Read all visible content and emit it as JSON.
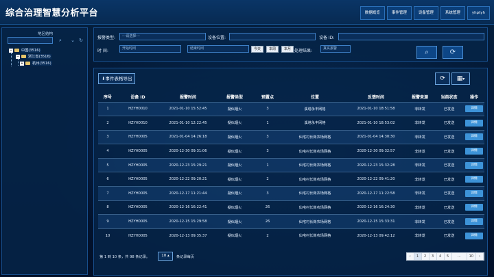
{
  "app": {
    "title": "综合治理智慧分析平台"
  },
  "nav": [
    {
      "label": "数据概览"
    },
    {
      "label": "事件管理"
    },
    {
      "label": "设备管理"
    },
    {
      "label": "系统管理"
    },
    {
      "label": "yhptyh"
    }
  ],
  "sidebar": {
    "title": "地区结构",
    "search_placeholder": "",
    "tree": [
      {
        "toggle": "−",
        "label": "中国(3516)"
      },
      {
        "toggle": "−",
        "label": "浙江省(3516)"
      },
      {
        "toggle": "+",
        "label": "杭州(3516)"
      }
    ]
  },
  "filter": {
    "alarm_type_label": "报警类型:",
    "alarm_type_value": "---请选择---",
    "device_location_label": "设备位置:",
    "device_location_value": "",
    "device_id_label": "设备 ID:",
    "device_id_value": "",
    "time_label": "时    间:",
    "start_placeholder": "开始时间",
    "end_placeholder": "结束时间",
    "today": "今天",
    "this_week": "本周",
    "this_month": "本月",
    "result_label": "处理结果:",
    "result_value": "真实报警"
  },
  "table": {
    "export_label": "事件表格导出",
    "headers": [
      "序号",
      "设备 ID",
      "报警时间",
      "报警类型",
      "预置点",
      "位置",
      "反馈时间",
      "报警来源",
      "当前状态",
      "操作"
    ],
    "detail_label": "详情",
    "rows": [
      [
        "1",
        "HZYH0010",
        "2021-01-10 15:52:45",
        "疑似烟火",
        "3",
        "溪塔永丰网格",
        "2021-01-10 18:51:58",
        "非转发",
        "已发送"
      ],
      [
        "2",
        "HZYH0010",
        "2021-01-10 12:22:45",
        "疑似烟火",
        "1",
        "溪塔永丰网格",
        "2021-01-10 18:53:02",
        "非转发",
        "已发送"
      ],
      [
        "3",
        "HZYH0005",
        "2021-01-04 14:26:18",
        "疑似烟火",
        "3",
        "仙宅村长岗农场网格",
        "2021-01-04 14:30:30",
        "非转发",
        "已发送"
      ],
      [
        "4",
        "HZYH0005",
        "2020-12-30 09:31:06",
        "疑似烟火",
        "3",
        "仙宅村长岗农场网格",
        "2020-12-30 09:32:57",
        "非转发",
        "已发送"
      ],
      [
        "5",
        "HZYH0005",
        "2020-12-23 15:29:21",
        "疑似烟火",
        "1",
        "仙宅村长岗农场网格",
        "2020-12-23 15:32:28",
        "非转发",
        "已发送"
      ],
      [
        "6",
        "HZYH0005",
        "2020-12-22 09:20:21",
        "疑似烟火",
        "2",
        "仙宅村长岗农场网格",
        "2020-12-22 09:41:20",
        "非转发",
        "已发送"
      ],
      [
        "7",
        "HZYH0005",
        "2020-12-17 11:21:44",
        "疑似烟火",
        "3",
        "仙宅村长岗农场网格",
        "2020-12-17 11:22:58",
        "非转发",
        "已发送"
      ],
      [
        "8",
        "HZYH0005",
        "2020-12-16 16:22:41",
        "疑似烟火",
        "26",
        "仙宅村长岗农场网格",
        "2020-12-16 16:24:30",
        "非转发",
        "已发送"
      ],
      [
        "9",
        "HZYH0005",
        "2020-12-15 15:29:58",
        "疑似烟火",
        "26",
        "仙宅村长岗农场网格",
        "2020-12-15 15:33:31",
        "非转发",
        "已发送"
      ],
      [
        "10",
        "HZYH0005",
        "2020-12-13 09:35:37",
        "疑似烟火",
        "2",
        "仙宅村长岗农场网格",
        "2020-12-13 09:42:12",
        "非转发",
        "已发送"
      ]
    ]
  },
  "pagination": {
    "info": "第 1 到 10 条，共 98 条记录。",
    "page_size": "10 ▴",
    "suffix": "条记录每页",
    "pages": [
      "‹",
      "1",
      "2",
      "3",
      "4",
      "5",
      "...",
      "10",
      "›"
    ],
    "active": "1"
  }
}
